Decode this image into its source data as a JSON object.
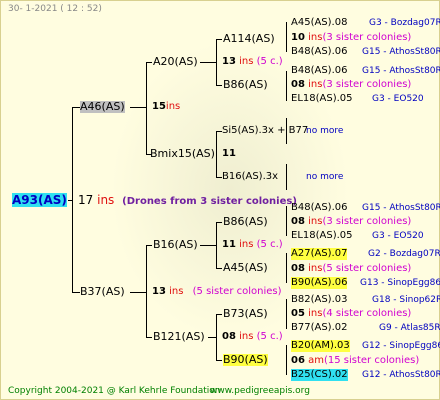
{
  "header": {
    "date": "30-   1-2021 ( 12 : 52)"
  },
  "root": {
    "name": "A93(AS)",
    "num": "17",
    "ins": "ins",
    "note": "(Drones from 3 sister colonies)"
  },
  "a46": {
    "name": "A46(AS)",
    "num": "15",
    "ins": "ins"
  },
  "a20": {
    "name": "A20(AS)",
    "num": "13",
    "ins": "ins",
    "col": "(5 c.)"
  },
  "a114": {
    "name": "A114(AS)"
  },
  "b86a": {
    "name": "B86(AS)"
  },
  "bmix": {
    "name": "Bmix15(AS)",
    "num": "11"
  },
  "si5": {
    "name": "Si5(AS).3x + B77",
    "more": "no more"
  },
  "b16x": {
    "name": "B16(AS).3x",
    "more": "no more"
  },
  "b37": {
    "name": "B37(AS)",
    "num": "13",
    "ins": "ins",
    "col": "(5 sister colonies)"
  },
  "b16": {
    "name": "B16(AS)",
    "num": "11",
    "ins": "ins",
    "col": "(5 c.)"
  },
  "b86b": {
    "name": "B86(AS)"
  },
  "a45": {
    "name": "A45(AS)"
  },
  "b121": {
    "name": "B121(AS)",
    "num": "08",
    "ins": "ins",
    "col": "(5 c.)"
  },
  "b73": {
    "name": "B73(AS)"
  },
  "b90": {
    "name": "B90(AS)"
  },
  "g1": {
    "name": "A45(AS).08",
    "num": "10",
    "ins": "ins",
    "col": "(3 sister colonies)",
    "info": "G3 - Bozdag07R",
    "tail": "B48(AS).06",
    "tailinfo": "G15 - AthosSt80R"
  },
  "g2": {
    "name": "B48(AS).06",
    "num": "08",
    "ins": "ins",
    "col": "(3 sister colonies)",
    "info": "G15 - AthosSt80R",
    "tail": "EL18(AS).05",
    "tailinfo": "G3 - EO520"
  },
  "g3": {
    "name": "B48(AS).06",
    "num": "08",
    "ins": "ins",
    "col": "(3 sister colonies)",
    "info": "G15 - AthosSt80R",
    "tail": "EL18(AS).05",
    "tailinfo": "G3 - EO520"
  },
  "g4": {
    "name": "A27(AS).07",
    "num": "08",
    "ins": "ins",
    "col": "(5 sister colonies)",
    "info": "G2 - Bozdag07R",
    "tail": "B90(AS).06",
    "tailinfo": "G13 - SinopEgg86R"
  },
  "g5": {
    "name": "B82(AS).03",
    "num": "05",
    "ins": "ins",
    "col": "(4 sister colonies)",
    "info": "G18 - Sinop62R",
    "tail": "B77(AS).02",
    "tailinfo": "G9 - Atlas85R"
  },
  "g6": {
    "name": "B20(AM).03",
    "num": "06",
    "ins": "am",
    "col": "(15 sister colonies)",
    "info": "G12 - SinopEgg86R",
    "tail": "B25(CS).02",
    "tailinfo": "G12 - AthosSt80R"
  },
  "footer": {
    "copyright": "Copyright 2004-2021 @ Karl Kehrle Foundation",
    "url": "www.pedigreeapis.org"
  }
}
